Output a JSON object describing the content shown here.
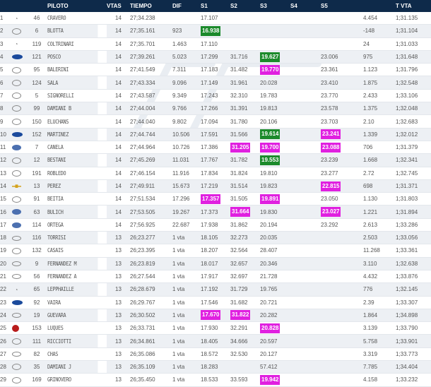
{
  "headers": {
    "pos": "",
    "car": "",
    "num": "",
    "piloto": "PILOTO",
    "vtas": "VTAS",
    "tiempo": "TIEMPO",
    "dif": "DIF",
    "s1": "S1",
    "s2": "S2",
    "s3": "S3",
    "s4": "S4",
    "s5": "S5",
    "gap": "",
    "tvta": "T VTA"
  },
  "colors": {
    "header_bg": "#0e2a4a",
    "green": "#1b8a2b",
    "magenta": "#e020e0"
  },
  "rows": [
    {
      "pos": "1",
      "car": "tilde",
      "num": "46",
      "piloto": "CRAVERO",
      "vtas": "14",
      "tiempo": "27;34.238",
      "dif": "",
      "s1": "17.107",
      "s2": "",
      "s3": "",
      "s4": "",
      "s5": "",
      "gap": "4.454",
      "tvta": "1;31.135"
    },
    {
      "pos": "2",
      "car": "toy",
      "num": "6",
      "piloto": "BLOTTA",
      "vtas": "14",
      "tiempo": "27;35.161",
      "dif": "923",
      "s1": "16.938",
      "s1_hl": "green",
      "s2": "",
      "s3": "",
      "s4": "",
      "s5": "",
      "gap": "-148",
      "tvta": "1;31.104"
    },
    {
      "pos": "3",
      "car": "tilde",
      "num": "119",
      "piloto": "COLTRINARI",
      "vtas": "14",
      "tiempo": "27;35.701",
      "dif": "1.463",
      "s1": "17.110",
      "s2": "",
      "s3": "",
      "s4": "",
      "s5": "",
      "gap": "24",
      "tvta": "1;31.033"
    },
    {
      "pos": "4",
      "car": "ford",
      "num": "121",
      "piloto": "POSCO",
      "vtas": "14",
      "tiempo": "27;39.261",
      "dif": "5.023",
      "s1": "17.299",
      "s2": "31.716",
      "s3": "19.627",
      "s3_hl": "green",
      "s4": "",
      "s5": "23.006",
      "gap": "975",
      "tvta": "1;31.648"
    },
    {
      "pos": "5",
      "car": "toy",
      "num": "95",
      "piloto": "BALERINI",
      "vtas": "14",
      "tiempo": "27;41.549",
      "dif": "7.311",
      "s1": "17.183",
      "s2": "31.482",
      "s3": "19.770",
      "s3_hl": "magenta",
      "s4": "",
      "s5": "23.361",
      "gap": "1.123",
      "tvta": "1;31.796"
    },
    {
      "pos": "6",
      "car": "toy",
      "num": "124",
      "piloto": "SALA",
      "vtas": "14",
      "tiempo": "27;43.334",
      "dif": "9.096",
      "s1": "17.149",
      "s2": "31.961",
      "s3": "20.028",
      "s4": "",
      "s5": "23.410",
      "gap": "1.875",
      "tvta": "1;32.548"
    },
    {
      "pos": "7",
      "car": "toy",
      "num": "5",
      "piloto": "SIGNORELLI",
      "vtas": "14",
      "tiempo": "27;43.587",
      "dif": "9.349",
      "s1": "17.243",
      "s2": "32.310",
      "s3": "19.783",
      "s4": "",
      "s5": "23.770",
      "gap": "2.433",
      "tvta": "1;33.106"
    },
    {
      "pos": "8",
      "car": "toy",
      "num": "99",
      "piloto": "DAMIANI B",
      "vtas": "14",
      "tiempo": "27;44.004",
      "dif": "9.766",
      "s1": "17.266",
      "s2": "31.391",
      "s3": "19.813",
      "s4": "",
      "s5": "23.578",
      "gap": "1.375",
      "tvta": "1;32.048"
    },
    {
      "pos": "9",
      "car": "toy",
      "num": "150",
      "piloto": "ELUCHANS",
      "vtas": "14",
      "tiempo": "27;44.040",
      "dif": "9.802",
      "s1": "17.094",
      "s2": "31.780",
      "s3": "20.106",
      "s4": "",
      "s5": "23.703",
      "gap": "2.10",
      "tvta": "1;32.683"
    },
    {
      "pos": "10",
      "car": "ford",
      "num": "152",
      "piloto": "MARTINEZ",
      "vtas": "14",
      "tiempo": "27;44.744",
      "dif": "10.506",
      "s1": "17.591",
      "s2": "31.566",
      "s3": "19.614",
      "s3_hl": "green",
      "s4": "",
      "s5": "23.241",
      "s5_hl": "magenta",
      "gap": "1.339",
      "tvta": "1;32.012"
    },
    {
      "pos": "11",
      "car": "vw",
      "num": "7",
      "piloto": "CANELA",
      "vtas": "14",
      "tiempo": "27;44.964",
      "dif": "10.726",
      "s1": "17.386",
      "s2": "31.205",
      "s2_hl": "magenta",
      "s3": "19.700",
      "s3_hl": "magenta",
      "s4": "",
      "s5": "23.088",
      "s5_hl": "magenta",
      "gap": "706",
      "tvta": "1;31.379"
    },
    {
      "pos": "12",
      "car": "toy",
      "num": "12",
      "piloto": "BESTANI",
      "vtas": "14",
      "tiempo": "27;45.269",
      "dif": "11.031",
      "s1": "17.767",
      "s2": "31.782",
      "s3": "19.553",
      "s3_hl": "green",
      "s4": "",
      "s5": "23.239",
      "gap": "1.668",
      "tvta": "1;32.341"
    },
    {
      "pos": "13",
      "car": "toy",
      "num": "191",
      "piloto": "ROBLEDO",
      "vtas": "14",
      "tiempo": "27;46.154",
      "dif": "11.916",
      "s1": "17.834",
      "s2": "31.824",
      "s3": "19.810",
      "s4": "",
      "s5": "23.277",
      "gap": "2.72",
      "tvta": "1;32.745"
    },
    {
      "pos": "14",
      "car": "chev",
      "num": "13",
      "piloto": "PEREZ",
      "vtas": "14",
      "tiempo": "27;49.911",
      "dif": "15.673",
      "s1": "17.219",
      "s2": "31.514",
      "s3": "19.823",
      "s4": "",
      "s5": "22.815",
      "s5_hl": "magenta",
      "gap": "698",
      "tvta": "1;31.371"
    },
    {
      "pos": "15",
      "car": "toy",
      "num": "91",
      "piloto": "BEITIA",
      "vtas": "14",
      "tiempo": "27;51.534",
      "dif": "17.296",
      "s1": "17.357",
      "s1_hl": "magenta",
      "s2": "31.505",
      "s3": "19.891",
      "s3_hl": "magenta",
      "s4": "",
      "s5": "23.050",
      "gap": "1.130",
      "tvta": "1;31.803"
    },
    {
      "pos": "16",
      "car": "vw",
      "num": "63",
      "piloto": "BULICH",
      "vtas": "14",
      "tiempo": "27;53.505",
      "dif": "19.267",
      "s1": "17.373",
      "s2": "31.664",
      "s2_hl": "magenta",
      "s3": "19.830",
      "s4": "",
      "s5": "23.027",
      "s5_hl": "magenta",
      "gap": "1.221",
      "tvta": "1;31.894"
    },
    {
      "pos": "17",
      "car": "vw",
      "num": "114",
      "piloto": "ORTEGA",
      "vtas": "14",
      "tiempo": "27;56.925",
      "dif": "22.687",
      "s1": "17.938",
      "s2": "31.862",
      "s3": "20.194",
      "s4": "",
      "s5": "23.292",
      "gap": "2.613",
      "tvta": "1;33.286"
    },
    {
      "pos": "18",
      "car": "dodge",
      "num": "116",
      "piloto": "TORRISI",
      "vtas": "13",
      "tiempo": "26;23.277",
      "dif": "1 vta",
      "s1": "18.105",
      "s2": "32.273",
      "s3": "20.035",
      "s4": "",
      "s5": "",
      "gap": "2.503",
      "tvta": "1;33.056"
    },
    {
      "pos": "19",
      "car": "toy",
      "num": "132",
      "piloto": "CASAIS",
      "vtas": "13",
      "tiempo": "26;23.395",
      "dif": "1 vta",
      "s1": "18.207",
      "s2": "32.564",
      "s3": "28.407",
      "s4": "",
      "s5": "",
      "gap": "11.268",
      "tvta": "1;33.361"
    },
    {
      "pos": "20",
      "car": "dodge",
      "num": "9",
      "piloto": "FERNANDEZ M",
      "vtas": "13",
      "tiempo": "26;23.819",
      "dif": "1 vta",
      "s1": "18.017",
      "s2": "32.657",
      "s3": "20.346",
      "s4": "",
      "s5": "",
      "gap": "3.110",
      "tvta": "1;32.638"
    },
    {
      "pos": "21",
      "car": "dodge",
      "num": "56",
      "piloto": "FERNANDEZ A",
      "vtas": "13",
      "tiempo": "26;27.544",
      "dif": "1 vta",
      "s1": "17.917",
      "s2": "32.697",
      "s3": "21.728",
      "s4": "",
      "s5": "",
      "gap": "4.432",
      "tvta": "1;33.876"
    },
    {
      "pos": "22",
      "car": "tilde",
      "num": "65",
      "piloto": "LEPPHAILLE",
      "vtas": "13",
      "tiempo": "26;28.679",
      "dif": "1 vta",
      "s1": "17.192",
      "s2": "31.729",
      "s3": "19.765",
      "s4": "",
      "s5": "",
      "gap": "776",
      "tvta": "1;32.145"
    },
    {
      "pos": "23",
      "car": "ford",
      "num": "92",
      "piloto": "VAIRA",
      "vtas": "13",
      "tiempo": "26;29.767",
      "dif": "1 vta",
      "s1": "17.546",
      "s2": "31.682",
      "s3": "20.721",
      "s4": "",
      "s5": "",
      "gap": "2.39",
      "tvta": "1;33.307"
    },
    {
      "pos": "24",
      "car": "dodge",
      "num": "19",
      "piloto": "GUEVARA",
      "vtas": "13",
      "tiempo": "26;30.502",
      "dif": "1 vta",
      "s1": "17.670",
      "s1_hl": "magenta",
      "s2": "31.822",
      "s2_hl": "magenta",
      "s3": "20.282",
      "s4": "",
      "s5": "",
      "gap": "1.864",
      "tvta": "1;34.898"
    },
    {
      "pos": "25",
      "car": "torino",
      "num": "153",
      "piloto": "LUQUES",
      "vtas": "13",
      "tiempo": "26;33.731",
      "dif": "1 vta",
      "s1": "17.930",
      "s2": "32.291",
      "s3": "20.828",
      "s3_hl": "magenta",
      "s4": "",
      "s5": "",
      "gap": "3.139",
      "tvta": "1;33.790"
    },
    {
      "pos": "26",
      "car": "toy",
      "num": "111",
      "piloto": "RICCIOTTI",
      "vtas": "13",
      "tiempo": "26;34.861",
      "dif": "1 vta",
      "s1": "18.405",
      "s2": "34.666",
      "s3": "20.597",
      "s4": "",
      "s5": "",
      "gap": "5.758",
      "tvta": "1;33.901"
    },
    {
      "pos": "27",
      "car": "dodge",
      "num": "82",
      "piloto": "CHAS",
      "vtas": "13",
      "tiempo": "26;35.086",
      "dif": "1 vta",
      "s1": "18.572",
      "s2": "32.530",
      "s3": "20.127",
      "s4": "",
      "s5": "",
      "gap": "3.319",
      "tvta": "1;33.773"
    },
    {
      "pos": "28",
      "car": "toy",
      "num": "35",
      "piloto": "DAMIANI J",
      "vtas": "13",
      "tiempo": "26;35.109",
      "dif": "1 vta",
      "s1": "18.283",
      "s2": "",
      "s3": "57.412",
      "s4": "",
      "s5": "",
      "gap": "7.785",
      "tvta": "1;34.404"
    },
    {
      "pos": "29",
      "car": "toy",
      "num": "169",
      "piloto": "GRINOVERO",
      "vtas": "13",
      "tiempo": "26;35.450",
      "dif": "1 vta",
      "s1": "18.533",
      "s2": "33.593",
      "s3": "19.942",
      "s3_hl": "magenta",
      "s4": "",
      "s5": "",
      "gap": "4.158",
      "tvta": "1;33.232"
    }
  ]
}
